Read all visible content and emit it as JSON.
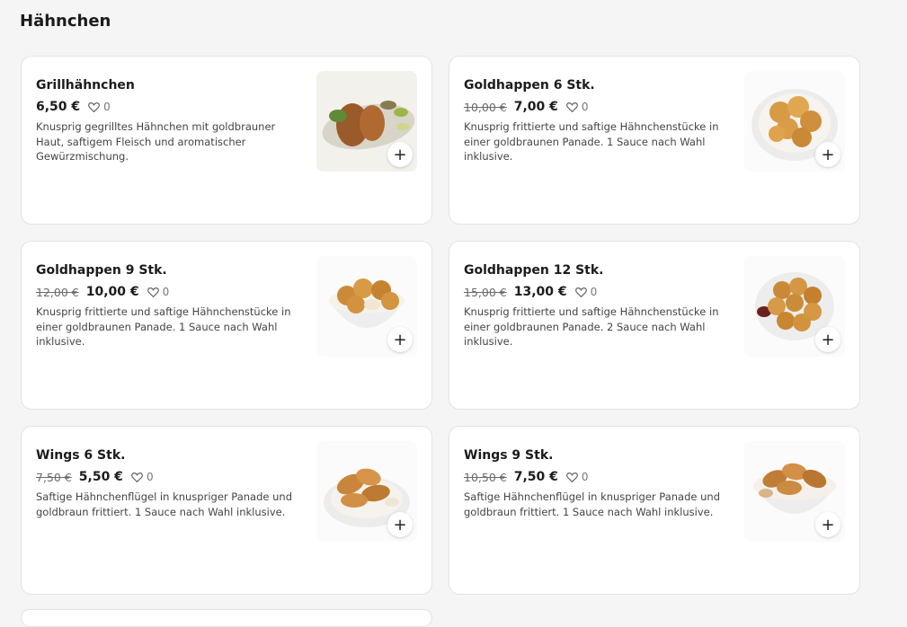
{
  "section": {
    "title": "Hähnchen"
  },
  "products": [
    {
      "name": "Grillhähnchen",
      "old_price": "",
      "price": "6,50 €",
      "likes": "0",
      "description": "Knusprig gegrilltes Hähnchen mit goldbrauner Haut, saftigem Fleisch und aromatischer Gewürzmischung.",
      "image": "grilled-chicken-plate",
      "add_label": "+"
    },
    {
      "name": "Goldhappen 6 Stk.",
      "old_price": "10,00 €",
      "price": "7,00 €",
      "likes": "0",
      "description": "Knusprig frittierte und saftige Hähnchenstücke in einer goldbraunen Panade. 1 Sauce nach Wahl inklusive.",
      "image": "chicken-nuggets-plate",
      "add_label": "+"
    },
    {
      "name": "Goldhappen 9 Stk.",
      "old_price": "12,00 €",
      "price": "10,00 €",
      "likes": "0",
      "description": "Knusprig frittierte und saftige Hähnchenstücke in einer goldbraunen Panade. 1 Sauce nach Wahl inklusive.",
      "image": "chicken-nuggets-bowl",
      "add_label": "+"
    },
    {
      "name": "Goldhappen 12 Stk.",
      "old_price": "15,00 €",
      "price": "13,00 €",
      "likes": "0",
      "description": "Knusprig frittierte und saftige Hähnchenstücke in einer goldbraunen Panade. 2 Sauce nach Wahl inklusive.",
      "image": "chicken-nuggets-bowl-large",
      "add_label": "+"
    },
    {
      "name": "Wings 6 Stk.",
      "old_price": "7,50 €",
      "price": "5,50 €",
      "likes": "0",
      "description": "Saftige Hähnchenflügel in knuspriger Panade und goldbraun frittiert. 1 Sauce nach Wahl inklusive.",
      "image": "chicken-wings-plate",
      "add_label": "+"
    },
    {
      "name": "Wings 9 Stk.",
      "old_price": "10,50 €",
      "price": "7,50 €",
      "likes": "0",
      "description": "Saftige Hähnchenflügel in knuspriger Panade und goldbraun frittiert. 1 Sauce nach Wahl inklusive.",
      "image": "chicken-wings-bowl",
      "add_label": "+"
    }
  ],
  "colors": {
    "background": "#f5f5f5",
    "card": "#ffffff",
    "text": "#1b1b1b",
    "muted": "#6b6b6b"
  }
}
